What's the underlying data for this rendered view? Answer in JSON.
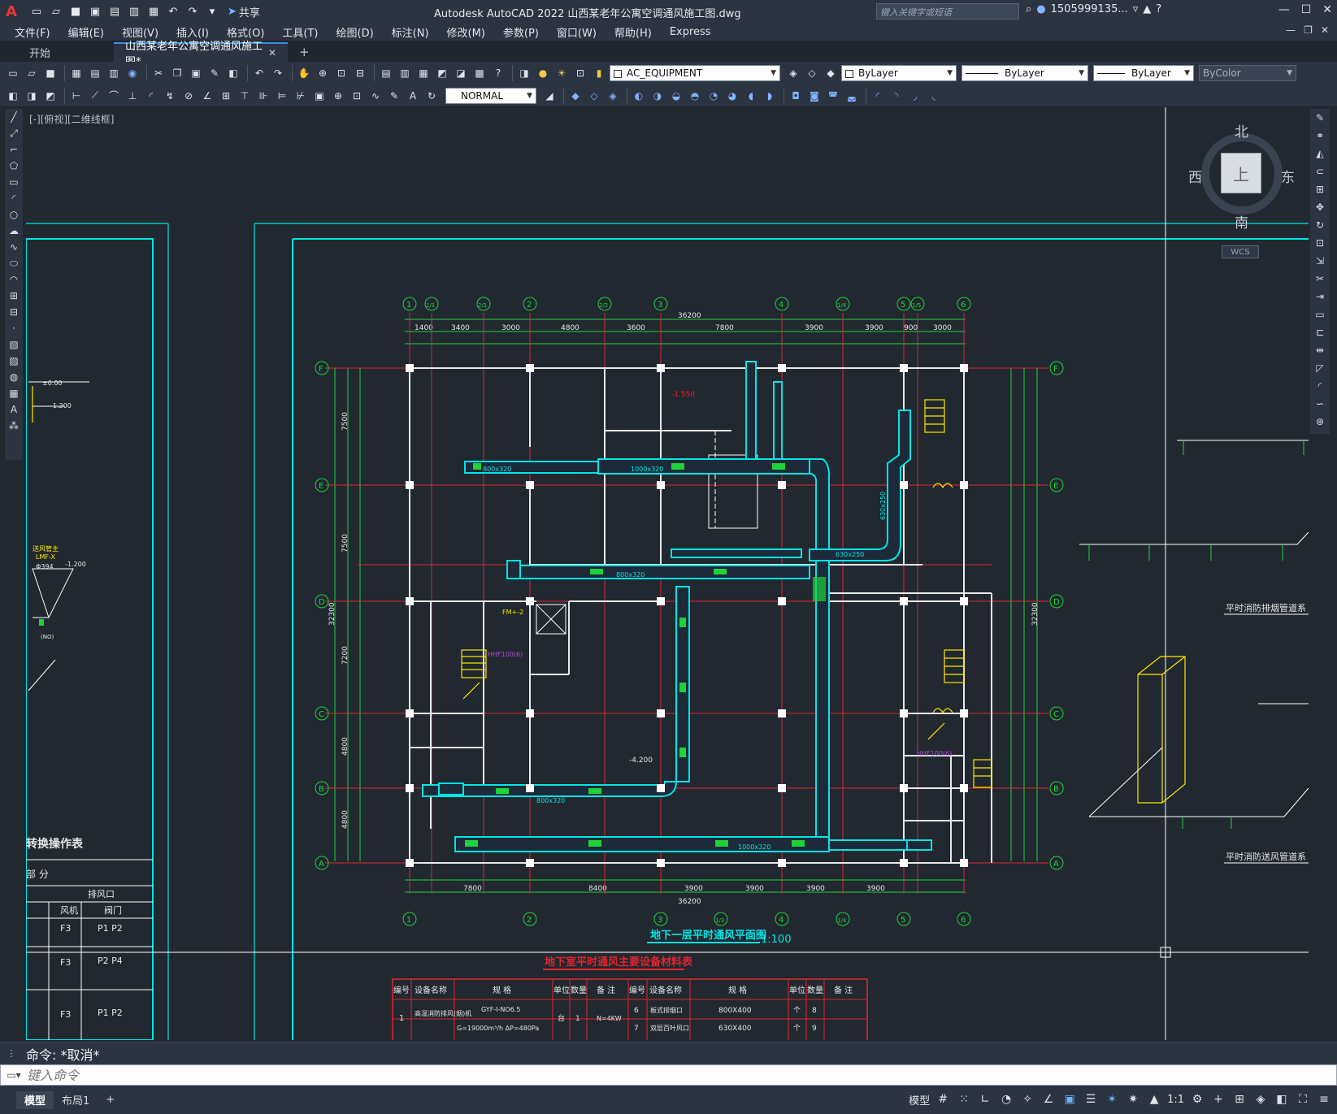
{
  "title_bar": {
    "app_title": "Autodesk AutoCAD 2022    山西某老年公寓空调通风施工图.dwg",
    "share_label": "共享",
    "search_placeholder": "键入关键字或短语",
    "user_name": "1505999135..."
  },
  "menu": {
    "items": [
      "文件(F)",
      "编辑(E)",
      "视图(V)",
      "插入(I)",
      "格式(O)",
      "工具(T)",
      "绘图(D)",
      "标注(N)",
      "修改(M)",
      "参数(P)",
      "窗口(W)",
      "帮助(H)",
      "Express"
    ]
  },
  "tabs": {
    "start": "开始",
    "active": "山西某老年公寓空调通风施工图*",
    "close_glyph": "✕",
    "add_glyph": "+"
  },
  "toolbar": {
    "layer_name": "AC_EQUIPMENT",
    "color": "ByLayer",
    "linetype": "ByLayer",
    "lineweight": "ByLayer",
    "plotstyle": "ByColor",
    "dim_style": "NORMAL"
  },
  "viewport": {
    "label": "[-][俯视][二维线框]",
    "viewcube": {
      "top_face": "上",
      "north": "北",
      "south": "南",
      "east": "东",
      "west": "西"
    },
    "wcs": "WCS"
  },
  "drawing": {
    "plan_title": "地下一层平时通风平面图",
    "plan_scale": "1:100",
    "table_title": "地下室平时通风主要设备材料表",
    "grid_columns": [
      "1",
      "1/1",
      "2/1",
      "2",
      "2/2",
      "3",
      "4",
      "1/4",
      "5",
      "1/5",
      "6"
    ],
    "grid_rows": [
      "F",
      "E",
      "D",
      "C",
      "B",
      "A"
    ],
    "top_total": "36200",
    "top_dims": [
      "1400",
      "3400",
      "3000",
      "4800",
      "3600",
      "7800",
      "3900",
      "3900",
      "900",
      "3000"
    ],
    "bottom_total": "36200",
    "bottom_dims": [
      "7800",
      "8400",
      "3900",
      "3900",
      "3900",
      "3900"
    ],
    "left_total": "32300",
    "left_dims": [
      "7500",
      "7500",
      "7200",
      "4800",
      "4800"
    ],
    "side_note_1": "平时消防排烟管道系",
    "side_note_2": "平时消防送风管道系",
    "left_table": {
      "title": "转换操作表",
      "header": "部  分",
      "sub_header": "排风口",
      "cols": [
        "风机",
        "阀门"
      ],
      "rows": [
        [
          "F3",
          "P1 P2"
        ],
        [
          "F3",
          "P2 P4"
        ],
        [
          "F3",
          "P1 P2"
        ]
      ]
    },
    "material_table": {
      "headers": [
        "编号",
        "设备名称",
        "规  格",
        "单位",
        "数量",
        "备  注",
        "编号",
        "设备名称",
        "规  格",
        "单位",
        "数量",
        "备  注"
      ],
      "rows": [
        [
          "1",
          "高温消防排风(烟)机",
          "GYF-I-NO6.5",
          "台",
          "1",
          "N=4KW",
          "6",
          "板式排烟口",
          "800X400",
          "个",
          "8",
          ""
        ],
        [
          "",
          "",
          "G=19000m³/h  ΔP=480Pa",
          "",
          "",
          "",
          "7",
          "双层百叶风口",
          "630X400",
          "个",
          "9",
          ""
        ]
      ]
    },
    "duct_labels": [
      "800x320",
      "1000x320",
      "800x320",
      "630x250",
      "800x320",
      "1000x320",
      "630x250"
    ]
  },
  "command": {
    "history": "命令:  *取消*",
    "placeholder": "键入命令"
  },
  "status": {
    "tabs": [
      "模型",
      "布局1"
    ],
    "model_label": "模型",
    "scale": "1:1"
  },
  "colors": {
    "background": "#212830",
    "cyan": "#00e5e5",
    "red": "#e0262f",
    "green": "#1ed33a",
    "white": "#ffffff",
    "yellow": "#ffe600",
    "magenta": "#b04fd8"
  }
}
